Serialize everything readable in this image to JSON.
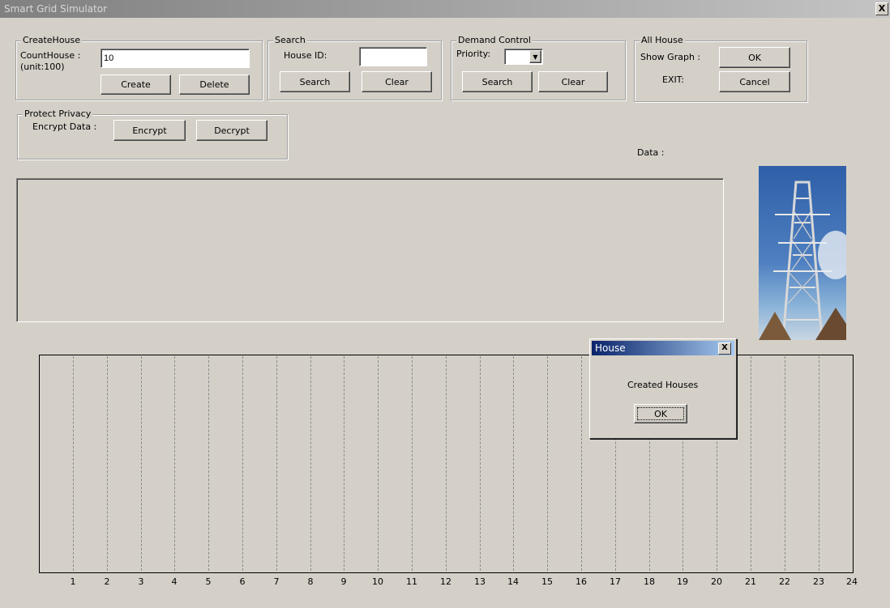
{
  "window": {
    "title": "Smart Grid Simulator",
    "close_glyph": "X"
  },
  "create_house": {
    "legend": "CreateHouse",
    "count_label": "CountHouse :",
    "unit_label": "(unit:100)",
    "count_value": "10",
    "create_label": "Create",
    "delete_label": "Delete"
  },
  "search": {
    "legend": "Search",
    "house_id_label": "House ID:",
    "house_id_value": "",
    "search_label": "Search",
    "clear_label": "Clear"
  },
  "demand": {
    "legend": "Demand Control",
    "priority_label": "Priority:",
    "priority_value": "",
    "search_label": "Search",
    "clear_label": "Clear"
  },
  "all_house": {
    "legend": "All House",
    "show_graph_label": "Show Graph :",
    "ok_label": "OK",
    "exit_label": "EXIT:",
    "cancel_label": "Cancel"
  },
  "privacy": {
    "legend": "Protect Privacy",
    "encrypt_label": "Encrypt Data :",
    "encrypt_button": "Encrypt",
    "decrypt_button": "Decrypt"
  },
  "data_label": "Data :",
  "graph": {
    "ticks": [
      "1",
      "2",
      "3",
      "4",
      "5",
      "6",
      "7",
      "8",
      "9",
      "10",
      "11",
      "12",
      "13",
      "14",
      "15",
      "16",
      "17",
      "18",
      "19",
      "20",
      "21",
      "22",
      "23",
      "24"
    ]
  },
  "dialog": {
    "title": "House",
    "message": "Created Houses",
    "ok_label": "OK",
    "close_glyph": "X"
  },
  "image": {
    "icon": "power-tower-photo"
  }
}
